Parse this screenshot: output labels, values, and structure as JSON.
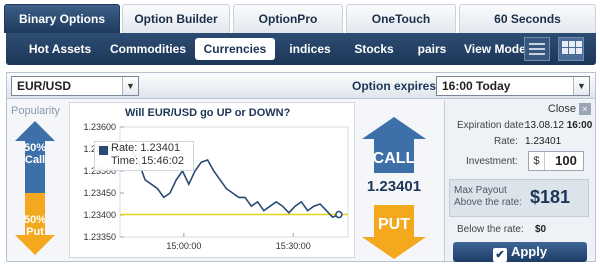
{
  "tabs": [
    {
      "label": "Binary Options",
      "active": true
    },
    {
      "label": "Option Builder",
      "active": false
    },
    {
      "label": "OptionPro",
      "active": false
    },
    {
      "label": "OneTouch",
      "active": false
    },
    {
      "label": "60 Seconds",
      "active": false
    }
  ],
  "subnav": {
    "items": [
      {
        "label": "Hot Assets"
      },
      {
        "label": "Commodities"
      },
      {
        "label": "Currencies",
        "active": true
      },
      {
        "label": "indices"
      },
      {
        "label": "Stocks"
      },
      {
        "label": "pairs"
      }
    ],
    "view_mode_label": "View Mode"
  },
  "toolbar": {
    "asset_value": "EUR/USD",
    "expires_label": "Option expires at",
    "expiry_value": "16:00 Today"
  },
  "popularity": {
    "label": "Popularity",
    "call_percent": "50%",
    "call_label": "Call",
    "put_percent": "50%",
    "put_label": "Put"
  },
  "chart": {
    "question": "Will EUR/USD go UP or DOWN?",
    "tooltip_rate": "Rate: 1.23401",
    "tooltip_time": "Time: 15:46:02"
  },
  "trade": {
    "call_label": "CALL",
    "put_label": "PUT",
    "current_rate": "1.23401"
  },
  "info": {
    "close_label": "Close",
    "close_glyph": "×",
    "expiration_label": "Expiration date:",
    "expiration_date": "13.08.12",
    "expiration_time": "16:00",
    "rate_label": "Rate:",
    "rate_value": "1.23401",
    "investment_label": "Investment:",
    "currency_symbol": "$",
    "investment_value": "100",
    "payout_label_1": "Max Payout",
    "payout_label_2": "Above the rate:",
    "payout_value": "$181",
    "below_label": "Below the rate:",
    "below_value": "$0",
    "apply_label": "Apply"
  },
  "colors": {
    "navy": "#1c3657",
    "blue_arrow": "#3d6fa8",
    "orange_arrow": "#f3a81d",
    "line": "#2a4a75",
    "rate_line": "#e7d21a"
  },
  "chart_data": {
    "type": "line",
    "xlabel": "",
    "ylabel": "",
    "x_ticks": [
      "15:00:00",
      "15:30:00"
    ],
    "y_ticks": [
      "1.23600",
      "1.23550",
      "1.23500",
      "1.23450",
      "1.23400",
      "1.23350"
    ],
    "ylim": [
      1.2335,
      1.236
    ],
    "reference_line": 1.23401,
    "series": [
      {
        "values": [
          1.23555,
          1.2355,
          1.23545,
          1.2352,
          1.2348,
          1.2347,
          1.2346,
          1.2344,
          1.2345,
          1.2348,
          1.235,
          1.2347,
          1.235,
          1.2352,
          1.23525,
          1.235,
          1.2348,
          1.2346,
          1.2345,
          1.2344,
          1.2344,
          1.2342,
          1.2343,
          1.2341,
          1.2342,
          1.2343,
          1.2342,
          1.23405,
          1.2342,
          1.2343,
          1.2341,
          1.2342,
          1.23425,
          1.2341,
          1.23395,
          1.23401
        ]
      }
    ]
  }
}
